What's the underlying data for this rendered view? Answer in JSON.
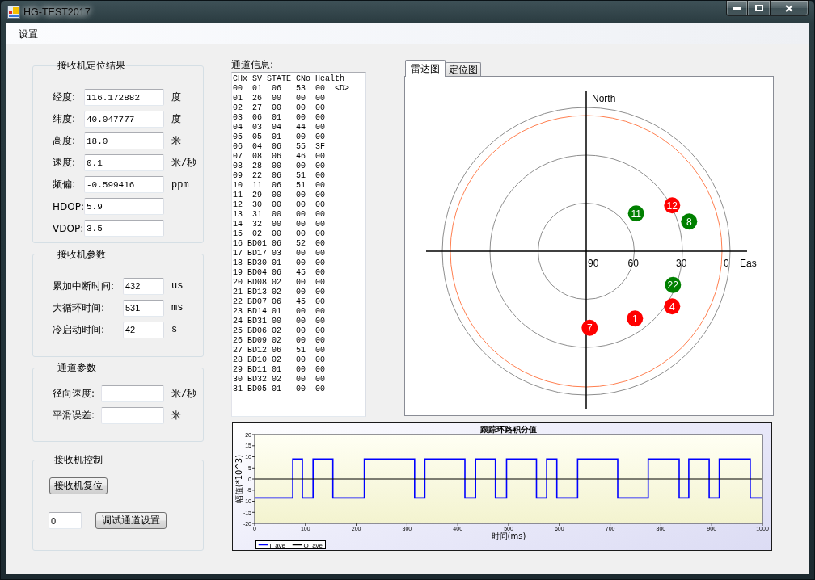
{
  "window": {
    "title": "HG-TEST2017"
  },
  "menu": [
    {
      "label": "设置"
    }
  ],
  "groups": [
    {
      "kind": "fields",
      "title": "接收机定位结果",
      "fields": [
        {
          "label": "经度:",
          "value": "116.172882",
          "unit": "度"
        },
        {
          "label": "纬度:",
          "value": "40.047777",
          "unit": "度"
        },
        {
          "label": "高度:",
          "value": "18.0",
          "unit": "米"
        },
        {
          "label": "速度:",
          "value": "0.1",
          "unit": "米/秒"
        },
        {
          "label": "频偏:",
          "value": "-0.599416",
          "unit": "ppm"
        },
        {
          "label": "HDOP:",
          "value": "5.9"
        },
        {
          "label": "VDOP:",
          "value": "3.5"
        }
      ]
    },
    {
      "kind": "fields",
      "title": "接收机参数",
      "fields": [
        {
          "label": "累加中断时间:",
          "value": "432",
          "unit": "us"
        },
        {
          "label": "大循环时间:",
          "value": "531",
          "unit": "ms"
        },
        {
          "label": "冷启动时间:",
          "value": "42",
          "unit": "s"
        }
      ]
    },
    {
      "kind": "fields",
      "title": "通道参数",
      "fields": [
        {
          "label": "径向速度:",
          "unit": "米/秒"
        },
        {
          "label": "平滑误差:",
          "unit": "米"
        }
      ]
    },
    {
      "kind": "controls",
      "title": "接收机控制",
      "reset_button": {
        "label": "接收机复位"
      },
      "channel_field": {
        "value": "0"
      },
      "debug_button": {
        "label": "调试通道设置"
      }
    }
  ],
  "channel_info": {
    "label": "通道信息:",
    "columns": [
      "CHx",
      "SV",
      "STATE",
      "CNo",
      "Health"
    ],
    "rows": [
      {
        "cells": [
          "00",
          "01",
          "06",
          "53",
          "00"
        ],
        "flag": "<D>"
      },
      {
        "cells": [
          "01",
          "26",
          "00",
          "00",
          "00"
        ]
      },
      {
        "cells": [
          "02",
          "27",
          "00",
          "00",
          "00"
        ]
      },
      {
        "cells": [
          "03",
          "06",
          "01",
          "00",
          "00"
        ]
      },
      {
        "cells": [
          "04",
          "03",
          "04",
          "44",
          "00"
        ]
      },
      {
        "cells": [
          "05",
          "05",
          "01",
          "00",
          "00"
        ]
      },
      {
        "cells": [
          "06",
          "04",
          "06",
          "55",
          "3F"
        ]
      },
      {
        "cells": [
          "07",
          "08",
          "06",
          "46",
          "00"
        ]
      },
      {
        "cells": [
          "08",
          "28",
          "00",
          "00",
          "00"
        ]
      },
      {
        "cells": [
          "09",
          "22",
          "06",
          "51",
          "00"
        ]
      },
      {
        "cells": [
          "10",
          "11",
          "06",
          "51",
          "00"
        ]
      },
      {
        "cells": [
          "11",
          "29",
          "00",
          "00",
          "00"
        ]
      },
      {
        "cells": [
          "12",
          "30",
          "00",
          "00",
          "00"
        ]
      },
      {
        "cells": [
          "13",
          "31",
          "00",
          "00",
          "00"
        ]
      },
      {
        "cells": [
          "14",
          "32",
          "00",
          "00",
          "00"
        ]
      },
      {
        "cells": [
          "15",
          "02",
          "00",
          "00",
          "00"
        ]
      },
      {
        "cells": [
          "16",
          "BD01",
          "06",
          "52",
          "00"
        ]
      },
      {
        "cells": [
          "17",
          "BD17",
          "03",
          "00",
          "00"
        ]
      },
      {
        "cells": [
          "18",
          "BD30",
          "01",
          "00",
          "00"
        ]
      },
      {
        "cells": [
          "19",
          "BD04",
          "06",
          "45",
          "00"
        ]
      },
      {
        "cells": [
          "20",
          "BD08",
          "02",
          "00",
          "00"
        ]
      },
      {
        "cells": [
          "21",
          "BD13",
          "02",
          "00",
          "00"
        ]
      },
      {
        "cells": [
          "22",
          "BD07",
          "06",
          "45",
          "00"
        ]
      },
      {
        "cells": [
          "23",
          "BD14",
          "01",
          "00",
          "00"
        ]
      },
      {
        "cells": [
          "24",
          "BD31",
          "00",
          "00",
          "00"
        ]
      },
      {
        "cells": [
          "25",
          "BD06",
          "02",
          "00",
          "00"
        ]
      },
      {
        "cells": [
          "26",
          "BD09",
          "02",
          "00",
          "00"
        ]
      },
      {
        "cells": [
          "27",
          "BD12",
          "06",
          "51",
          "00"
        ]
      },
      {
        "cells": [
          "28",
          "BD10",
          "02",
          "00",
          "00"
        ]
      },
      {
        "cells": [
          "29",
          "BD11",
          "01",
          "00",
          "00"
        ]
      },
      {
        "cells": [
          "30",
          "BD32",
          "02",
          "00",
          "00"
        ]
      },
      {
        "cells": [
          "31",
          "BD05",
          "01",
          "00",
          "00"
        ]
      }
    ]
  },
  "tabs": [
    {
      "label": "雷达图",
      "selected": true
    },
    {
      "label": "定位图",
      "selected": false
    }
  ],
  "sky_plot": {
    "north_label": "North",
    "east_label": "Eas",
    "ring_labels": [
      "90",
      "60",
      "30",
      "0"
    ],
    "satellites": [
      {
        "label": "11",
        "color": "#008000"
      },
      {
        "label": "12",
        "color": "#ff0000"
      },
      {
        "label": "8",
        "color": "#008000"
      },
      {
        "label": "22",
        "color": "#008000"
      },
      {
        "label": "4",
        "color": "#ff0000"
      },
      {
        "label": "1",
        "color": "#ff0000"
      },
      {
        "label": "7",
        "color": "#ff0000"
      }
    ]
  },
  "waveform": {
    "chart_data": {
      "type": "line",
      "title": "跟踪环路积分值",
      "xlabel": "时间(ms)",
      "ylabel": "幅值(*10^3)",
      "xlim": [
        0,
        1000
      ],
      "ylim": [
        -20,
        20
      ],
      "xticks": [
        0,
        100,
        200,
        300,
        400,
        500,
        600,
        700,
        800,
        900,
        1000
      ],
      "yticks": [
        -20,
        -15,
        -10,
        -5,
        0,
        5,
        10,
        15,
        20
      ],
      "legend": "lower left",
      "x": [
        0,
        75,
        75,
        94,
        94,
        115,
        115,
        154,
        154,
        216,
        216,
        315,
        315,
        335,
        335,
        414,
        414,
        435,
        435,
        474,
        474,
        496,
        496,
        555,
        555,
        575,
        575,
        595,
        595,
        636,
        636,
        715,
        715,
        775,
        775,
        836,
        836,
        855,
        855,
        895,
        895,
        915,
        915,
        976,
        976,
        1000
      ],
      "series": [
        {
          "name": "I_ave",
          "color": "#0000ff",
          "values": [
            -8.5,
            -8.5,
            9,
            9,
            -8.5,
            -8.5,
            9,
            9,
            -8.5,
            -8.5,
            9,
            9,
            -8.5,
            -8.5,
            9,
            9,
            -8.5,
            -8.5,
            9,
            9,
            -8.5,
            -8.5,
            9,
            9,
            -8.5,
            -8.5,
            9,
            9,
            -8.5,
            -8.5,
            9,
            9,
            -8.5,
            -8.5,
            9,
            9,
            -8.5,
            -8.5,
            9,
            9,
            -8.5,
            -8.5,
            9,
            9,
            -8.5,
            -8.5
          ]
        },
        {
          "name": "Q_ave",
          "color": "#000000",
          "values": [
            0,
            0,
            0,
            0,
            0,
            0,
            0,
            0,
            0,
            0,
            0,
            0,
            0,
            0,
            0,
            0,
            0,
            0,
            0,
            0,
            0,
            0,
            0,
            0,
            0,
            0,
            0,
            0,
            0,
            0,
            0,
            0,
            0,
            0,
            0,
            0,
            0,
            0,
            0,
            0,
            0,
            0,
            0,
            0,
            0,
            0
          ]
        }
      ]
    }
  }
}
